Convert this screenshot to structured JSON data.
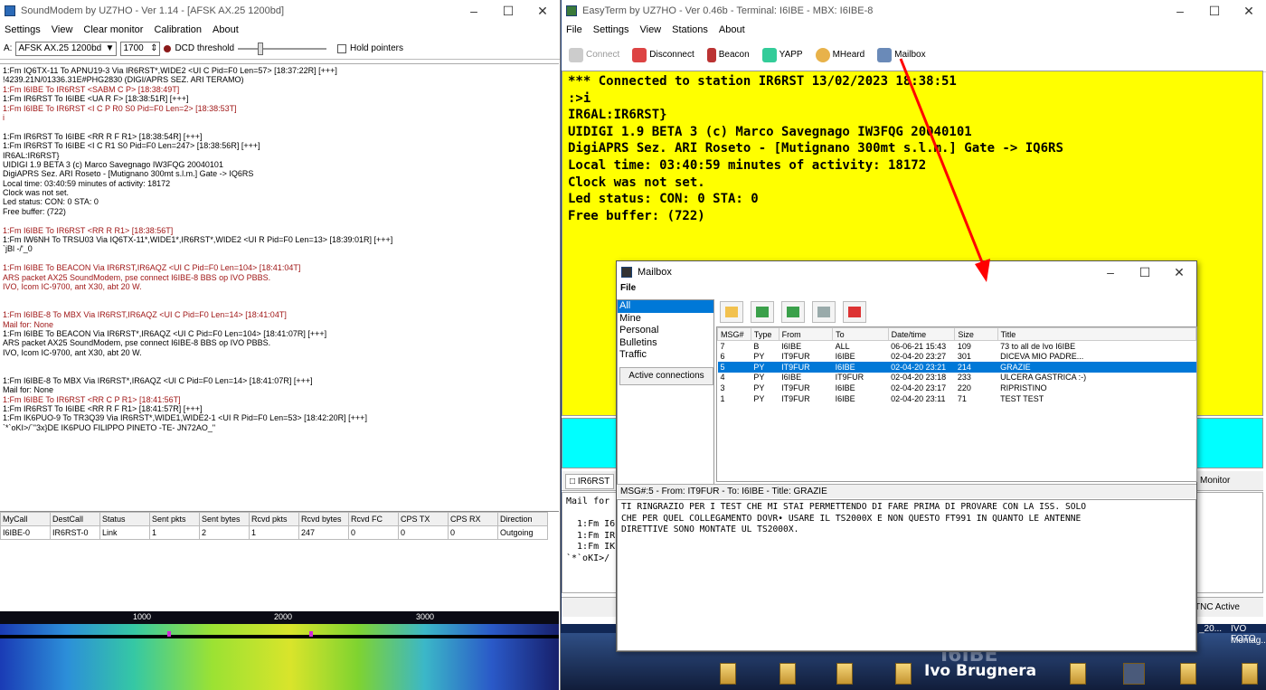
{
  "soundmodem": {
    "title": "SoundModem by UZ7HO - Ver 1.14 - [AFSK AX.25 1200bd]",
    "menu": [
      "Settings",
      "View",
      "Clear monitor",
      "Calibration",
      "About"
    ],
    "toolbar": {
      "channel_label": "A:",
      "mode_value": "AFSK AX.25 1200bd",
      "freq_value": "1700",
      "dcd_label": "DCD threshold",
      "hold_label": "Hold pointers"
    },
    "log": [
      {
        "t": "1:Fm IQ6TX-11 To APNU19-3 Via IR6RST*,WIDE2 <UI C Pid=F0 Len=57> [18:37:22R] [+++]",
        "c": ""
      },
      {
        "t": "!4239.21N/01336.31E#PHG2830 (DIGI/APRS SEZ. ARI TERAMO)",
        "c": ""
      },
      {
        "t": "1:Fm I6IBE To IR6RST <SABM C P> [18:38:49T]",
        "c": "red"
      },
      {
        "t": "1:Fm IR6RST To I6IBE <UA R F> [18:38:51R] [+++]",
        "c": ""
      },
      {
        "t": "1:Fm I6IBE To IR6RST <I C P R0 S0 Pid=F0 Len=2> [18:38:53T]",
        "c": "red"
      },
      {
        "t": "i",
        "c": "red"
      },
      {
        "t": "",
        "c": ""
      },
      {
        "t": "1:Fm IR6RST To I6IBE <RR R F R1> [18:38:54R] [+++]",
        "c": ""
      },
      {
        "t": "1:Fm IR6RST To I6IBE <I C R1 S0 Pid=F0 Len=247> [18:38:56R] [+++]",
        "c": ""
      },
      {
        "t": "IR6AL:IR6RST}",
        "c": ""
      },
      {
        "t": "UIDIGI 1.9 BETA 3 (c) Marco Savegnago IW3FQG 20040101",
        "c": ""
      },
      {
        "t": "DigiAPRS Sez. ARI Roseto - [Mutignano 300mt s.l.m.] Gate -> IQ6RS",
        "c": ""
      },
      {
        "t": "Local time: 03:40:59 minutes of activity: 18172",
        "c": ""
      },
      {
        "t": "Clock was not set.",
        "c": ""
      },
      {
        "t": "Led status: CON: 0 STA: 0",
        "c": ""
      },
      {
        "t": "Free buffer: (722)",
        "c": ""
      },
      {
        "t": "",
        "c": ""
      },
      {
        "t": "1:Fm I6IBE To IR6RST <RR R R1> [18:38:56T]",
        "c": "red"
      },
      {
        "t": "1:Fm IW6NH To TRSU03 Via IQ6TX-11*,WIDE1*,IR6RST*,WIDE2 <UI R Pid=F0 Len=13> [18:39:01R] [+++]",
        "c": ""
      },
      {
        "t": "`jBl -/'_0",
        "c": ""
      },
      {
        "t": "",
        "c": ""
      },
      {
        "t": "1:Fm I6IBE To BEACON Via IR6RST,IR6AQZ <UI C Pid=F0 Len=104> [18:41:04T]",
        "c": "red"
      },
      {
        "t": "ARS packet AX25 SoundModem, pse connect I6IBE-8 BBS op IVO PBBS.",
        "c": "red"
      },
      {
        "t": "IVO, Icom IC-9700, ant X30, abt 20 W.",
        "c": "red"
      },
      {
        "t": "",
        "c": ""
      },
      {
        "t": "",
        "c": ""
      },
      {
        "t": "1:Fm I6IBE-8 To MBX Via IR6RST,IR6AQZ <UI C Pid=F0 Len=14> [18:41:04T]",
        "c": "red"
      },
      {
        "t": "Mail for: None",
        "c": "red"
      },
      {
        "t": "1:Fm I6IBE To BEACON Via IR6RST*,IR6AQZ <UI C Pid=F0 Len=104> [18:41:07R] [+++]",
        "c": ""
      },
      {
        "t": "ARS packet AX25 SoundModem, pse connect I6IBE-8 BBS op IVO PBBS.",
        "c": ""
      },
      {
        "t": "IVO, Icom IC-9700, ant X30, abt 20 W.",
        "c": ""
      },
      {
        "t": "",
        "c": ""
      },
      {
        "t": "",
        "c": ""
      },
      {
        "t": "1:Fm I6IBE-8 To MBX Via IR6RST*,IR6AQZ <UI C Pid=F0 Len=14> [18:41:07R] [+++]",
        "c": ""
      },
      {
        "t": "Mail for: None",
        "c": ""
      },
      {
        "t": "1:Fm I6IBE To IR6RST <RR C P R1> [18:41:56T]",
        "c": "red"
      },
      {
        "t": "1:Fm IR6RST To I6IBE <RR R F R1> [18:41:57R] [+++]",
        "c": ""
      },
      {
        "t": "1:Fm IK6PUO-9 To TR3Q39 Via IR6RST*,WIDE1,WIDE2-1 <UI R Pid=F0 Len=53> [18:42:20R] [+++]",
        "c": ""
      },
      {
        "t": "`*`oKI>/`\"3x}DE IK6PUO FILIPPO PINETO -TE- JN72AO_\"",
        "c": ""
      }
    ],
    "table": {
      "headers": [
        "MyCall",
        "DestCall",
        "Status",
        "Sent pkts",
        "Sent bytes",
        "Rcvd pkts",
        "Rcvd bytes",
        "Rcvd FC",
        "CPS TX",
        "CPS RX",
        "Direction"
      ],
      "rows": [
        [
          "I6IBE-0",
          "IR6RST-0",
          "Link",
          "1",
          "2",
          "1",
          "247",
          "0",
          "0",
          "0",
          "Outgoing"
        ]
      ]
    },
    "waterfall_scale": [
      "1000",
      "2000",
      "3000"
    ]
  },
  "easyterm": {
    "title": "EasyTerm by UZ7HO - Ver 0.46b - Terminal: I6IBE - MBX: I6IBE-8",
    "menu": [
      "File",
      "Settings",
      "View",
      "Stations",
      "About"
    ],
    "toolbar": [
      "Connect",
      "Disconnect",
      "Beacon",
      "YAPP",
      "MHeard",
      "Mailbox"
    ],
    "terminal": [
      "*** Connected to station IR6RST 13/02/2023 18:38:51",
      ":>i",
      "IR6AL:IR6RST}",
      "UIDIGI 1.9 BETA 3 (c) Marco Savegnago IW3FQG 20040101",
      "DigiAPRS Sez. ARI Roseto - [Mutignano 300mt s.l.m.] Gate -> IQ6RS",
      "Local time: 03:40:59 minutes of activity: 18172",
      "Clock was not set.",
      "Led status: CON: 0 STA: 0",
      "Free buffer: (722)"
    ],
    "tab_left": "IR6RST",
    "tab_right": "Monitor",
    "lower": [
      "Mail for",
      "",
      "  1:Fm I6",
      "  1:Fm IR",
      "  1:Fm IK",
      "`*`oKI>/"
    ],
    "status_right": "TNC Active"
  },
  "mailbox": {
    "title": "Mailbox",
    "menu": "File",
    "folders": [
      "All",
      "Mine",
      "Personal",
      "Bulletins",
      "Traffic"
    ],
    "selected_folder": "All",
    "active_connections": "Active connections",
    "columns": [
      "MSG#",
      "Type",
      "From",
      "To",
      "Date/time",
      "Size",
      "Title"
    ],
    "messages": [
      [
        "7",
        "B",
        "I6IBE",
        "ALL",
        "06-06-21 15:43",
        "109",
        "73 to all de Ivo I6IBE"
      ],
      [
        "6",
        "PY",
        "IT9FUR",
        "I6IBE",
        "02-04-20 23:27",
        "301",
        "DICEVA MIO PADRE..."
      ],
      [
        "5",
        "PY",
        "IT9FUR",
        "I6IBE",
        "02-04-20 23:21",
        "214",
        "GRAZIE"
      ],
      [
        "4",
        "PY",
        "I6IBE",
        "IT9FUR",
        "02-04-20 23:18",
        "233",
        "ULCERA GASTRICA :-)"
      ],
      [
        "3",
        "PY",
        "IT9FUR",
        "I6IBE",
        "02-04-20 23:17",
        "220",
        "RIPRISTINO"
      ],
      [
        "1",
        "PY",
        "IT9FUR",
        "I6IBE",
        "02-04-20 23:11",
        "71",
        "TEST TEST"
      ]
    ],
    "selected_msg": "5",
    "header": "MSG#:5 - From: IT9FUR - To: I6IBE - Title: GRAZIE",
    "body": [
      "TI RINGRAZIO PER I TEST CHE MI STAI PERMETTENDO DI FARE PRIMA DI PROVARE CON LA ISS. SOLO",
      "CHE PER QUEL COLLEGAMENTO DOVR• USARE IL TS2000X E NON QUESTO FT991 IN QUANTO LE ANTENNE",
      "DIRETTIVE SONO MONTATE UL TS2000X."
    ]
  },
  "desktop": {
    "callsign": "I6IBE",
    "name": "Ivo Brugnera",
    "labels": [
      "_20...",
      "IVO FOTO",
      "Montag..."
    ]
  },
  "colors": {
    "terminal_bg": "#ffff00",
    "panel_cyan": "#00ffff",
    "selection": "#0078d7",
    "log_red": "#a01818",
    "arrow": "#ff0000"
  }
}
